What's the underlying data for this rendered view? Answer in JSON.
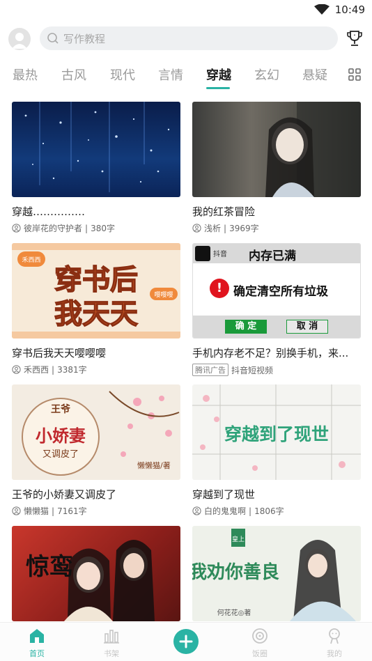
{
  "status": {
    "time": "10:49"
  },
  "search": {
    "placeholder": "写作教程"
  },
  "tabs": [
    {
      "label": "最热"
    },
    {
      "label": "古风"
    },
    {
      "label": "现代"
    },
    {
      "label": "言情"
    },
    {
      "label": "穿越",
      "active": true
    },
    {
      "label": "玄幻"
    },
    {
      "label": "悬疑"
    }
  ],
  "cards": [
    {
      "title": "穿越……………",
      "author": "彼岸花的守护者",
      "count": "380字"
    },
    {
      "title": "我的红茶冒险",
      "author": "浅析",
      "count": "3969字"
    },
    {
      "title": "穿书后我天天嘤嘤嘤",
      "author": "禾西西",
      "count": "3381字",
      "cover_text": [
        "穿书后",
        "我天天"
      ],
      "cover_badge": "禾西西",
      "cover_corner": "嘤嘤嘤"
    },
    {
      "title": "手机内存老不足？别换手机，来...",
      "ad_tag": "腾讯广告",
      "advertiser": "抖音短视频",
      "ad": {
        "brand": "抖音",
        "headline": "内存已满",
        "message": "确定清空所有垃圾",
        "confirm": "确 定",
        "cancel": "取 消"
      }
    },
    {
      "title": "王爷的小娇妻又调皮了",
      "author": "懒懒猫",
      "count": "7161字",
      "cover_text": [
        "王爷",
        "小娇妻",
        "又调皮了"
      ],
      "cover_sign": "懒懒猫/著"
    },
    {
      "title": "穿越到了现世",
      "author": "白的鬼鬼啊",
      "count": "1806字",
      "cover_text": "穿越到了现世"
    },
    {
      "title": "",
      "cover_text": "惊鸾"
    },
    {
      "title": "",
      "cover_text": [
        "皇上",
        "我劝你善良"
      ],
      "cover_sign": "何花花◎著"
    }
  ],
  "nav": [
    {
      "label": "首页",
      "icon": "home-icon",
      "active": true
    },
    {
      "label": "书架",
      "icon": "bookshelf-icon"
    },
    {
      "label": "",
      "icon": "plus-icon"
    },
    {
      "label": "饭圈",
      "icon": "circle-icon"
    },
    {
      "label": "我的",
      "icon": "profile-icon"
    }
  ],
  "colors": {
    "accent": "#2ab3a4"
  }
}
